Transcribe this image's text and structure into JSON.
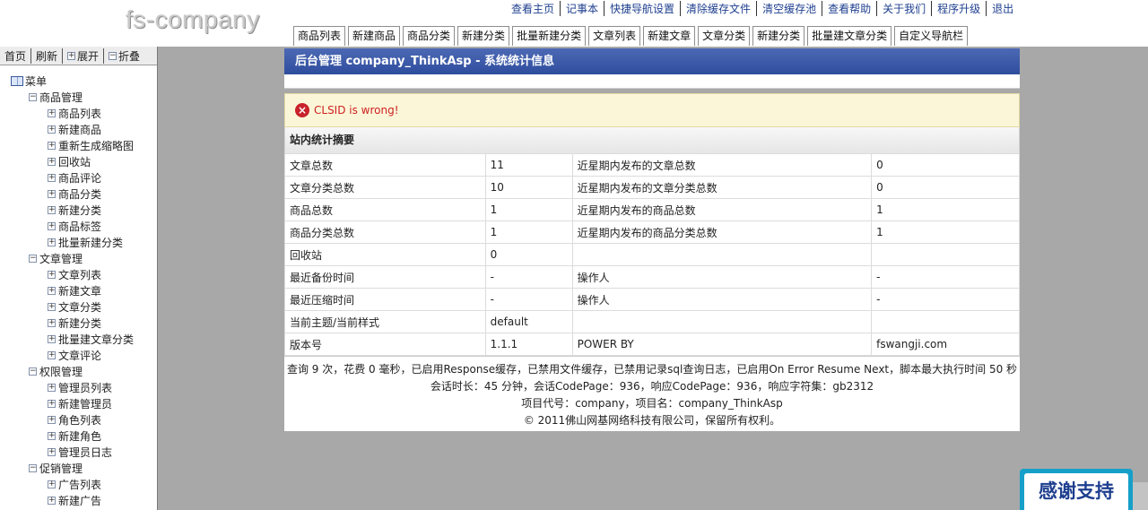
{
  "logo": "fs-company",
  "top_links": [
    "查看主页",
    "记事本",
    "快捷导航设置",
    "清除缓存文件",
    "清空缓存池",
    "查看帮助",
    "关于我们",
    "程序升级",
    "退出"
  ],
  "tabs": [
    "商品列表",
    "新建商品",
    "商品分类",
    "新建分类",
    "批量新建分类",
    "文章列表",
    "新建文章",
    "文章分类",
    "新建分类",
    "批量建文章分类",
    "自定义导航栏"
  ],
  "sidebar": {
    "tools": [
      "首页",
      "刷新",
      "展开",
      "折叠"
    ],
    "root": "菜单",
    "groups": [
      {
        "label": "商品管理",
        "items": [
          "商品列表",
          "新建商品",
          "重新生成缩略图",
          "回收站",
          "商品评论",
          "商品分类",
          "新建分类",
          "商品标签",
          "批量新建分类"
        ]
      },
      {
        "label": "文章管理",
        "items": [
          "文章列表",
          "新建文章",
          "文章分类",
          "新建分类",
          "批量建文章分类",
          "文章评论"
        ]
      },
      {
        "label": "权限管理",
        "items": [
          "管理员列表",
          "新建管理员",
          "角色列表",
          "新建角色",
          "管理员日志"
        ]
      },
      {
        "label": "促销管理",
        "items": [
          "广告列表",
          "新建广告"
        ]
      }
    ]
  },
  "main": {
    "title": "后台管理  company_ThinkAsp - 系统统计信息",
    "error": "CLSID is wrong!",
    "stats_title": "站内统计摘要",
    "rows": [
      [
        "文章总数",
        "11",
        "近星期内发布的文章总数",
        "0"
      ],
      [
        "文章分类总数",
        "10",
        "近星期内发布的文章分类总数",
        "0"
      ],
      [
        "商品总数",
        "1",
        "近星期内发布的商品总数",
        "1"
      ],
      [
        "商品分类总数",
        "1",
        "近星期内发布的商品分类总数",
        "1"
      ],
      [
        "回收站",
        "0",
        "",
        ""
      ],
      [
        "最近备份时间",
        "-",
        "操作人",
        "-"
      ],
      [
        "最近压缩时间",
        "-",
        "操作人",
        "-"
      ],
      [
        "当前主题/当前样式",
        "default",
        "",
        ""
      ],
      [
        "版本号",
        "1.1.1",
        "POWER BY",
        "fswangji.com"
      ]
    ]
  },
  "footer": {
    "line1": "查询 9 次，花费 0 毫秒，已启用Response缓存，已禁用文件缓存，已禁用记录sql查询日志，已启用On Error Resume Next，脚本最大执行时间 50 秒",
    "line2": "会话时长：45 分钟，会话CodePage：936，响应CodePage：936，响应字符集：gb2312",
    "line3": "项目代号：company，项目名：company_ThinkAsp",
    "line4": "© 2011佛山网基网络科技有限公司，保留所有权利。"
  },
  "thanks": "感谢支持"
}
